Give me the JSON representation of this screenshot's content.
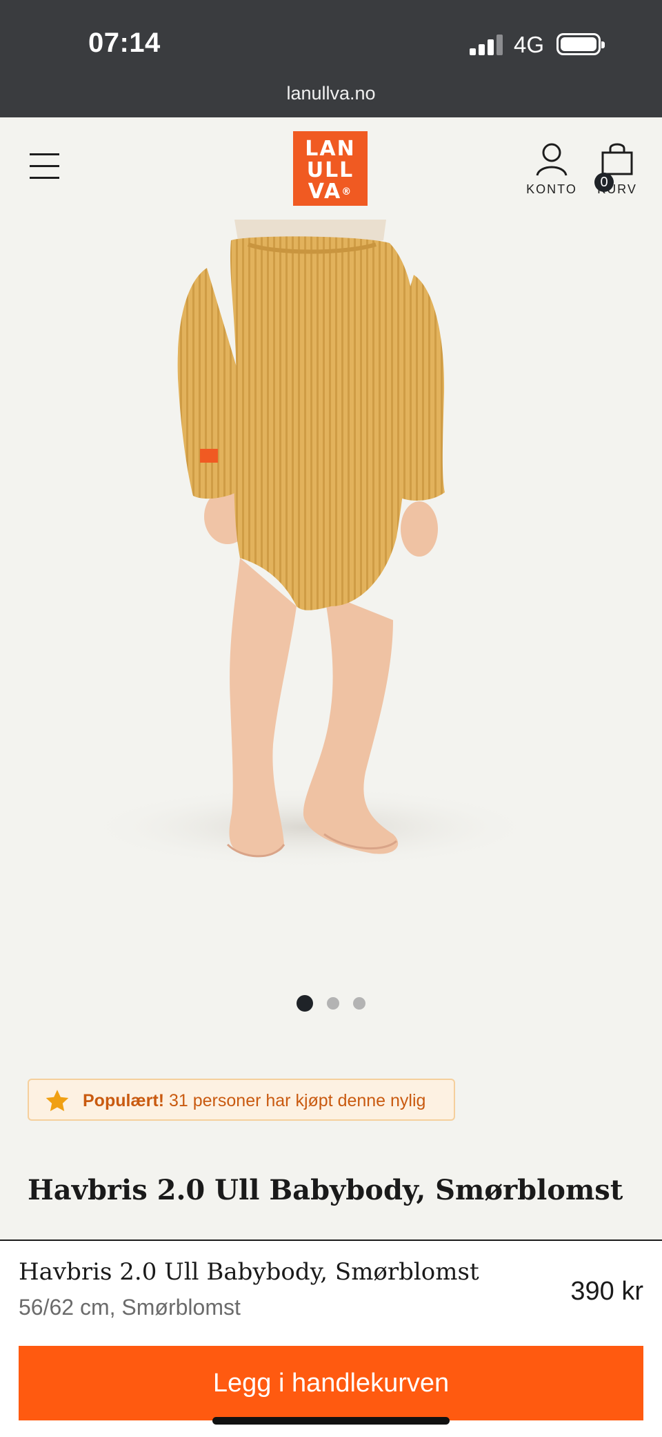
{
  "status_bar": {
    "time": "07:14",
    "network": "4G"
  },
  "browser": {
    "url": "lanullva.no"
  },
  "header": {
    "logo_lines": [
      "LAN",
      "ULL",
      "VA"
    ],
    "logo_mark": "®",
    "account_label": "KONTO",
    "cart_label": "KURV",
    "cart_count": "0"
  },
  "gallery": {
    "total_images": 3,
    "active_index": 0
  },
  "popular_badge": {
    "strong": "Populært!",
    "text": "31 personer har kjøpt denne nylig"
  },
  "product": {
    "title": "Havbris 2.0 Ull Babybody, Smørblomst"
  },
  "sticky_bar": {
    "name": "Havbris 2.0 Ull Babybody, Smørblomst",
    "variant": "56/62 cm, Smørblomst",
    "price": "390 kr",
    "cta": "Legg i handlekurven"
  },
  "colors": {
    "brand_orange": "#f05a22",
    "cta_orange": "#ff5a10",
    "badge_text": "#c95a10",
    "body_mustard": "#e2b25c"
  }
}
